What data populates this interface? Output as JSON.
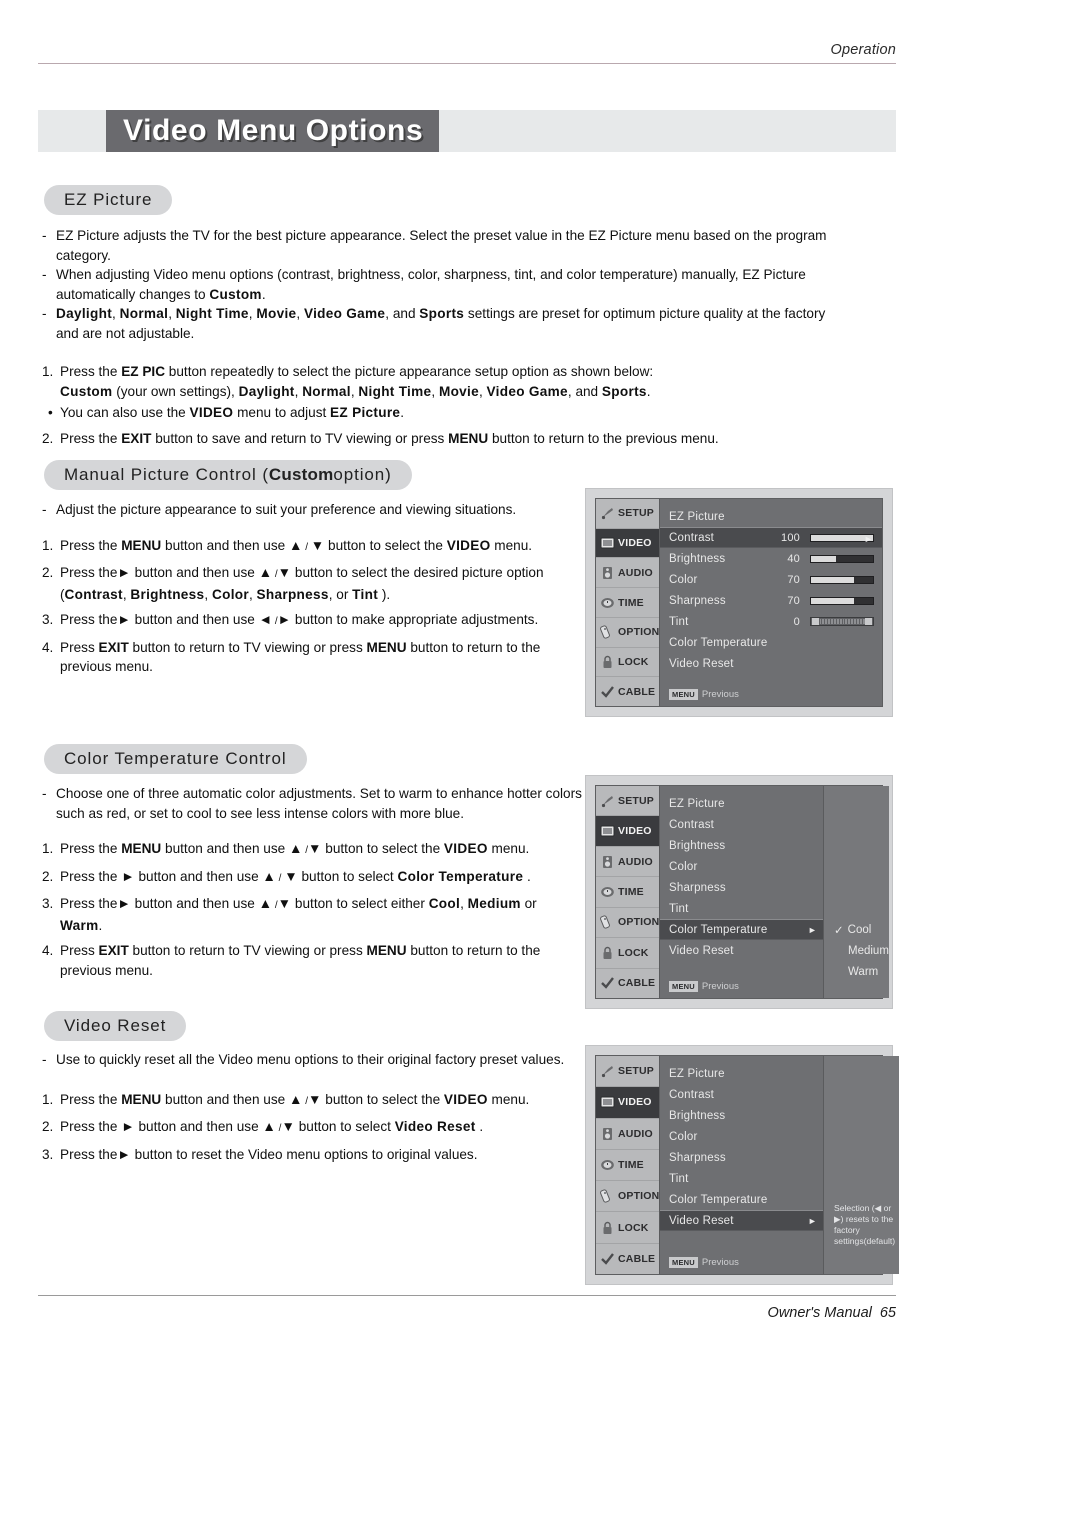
{
  "header": {
    "running_head": "Operation"
  },
  "banner": {
    "title": "Video Menu Options"
  },
  "sections": {
    "ez_picture": {
      "pill": "EZ Picture",
      "bullets": [
        "EZ Picture adjusts the TV for the best picture appearance. Select the preset value in the EZ Picture menu based on the program category.",
        "When adjusting Video menu options (contrast, brightness, color, sharpness, tint, and color temperature) manually, EZ Picture automatically changes to Custom.",
        "Daylight, Normal, Night Time, Movie, Video Game, and Sports settings are preset for optimum picture quality at the factory and are not adjustable."
      ],
      "step1_a": "Press the",
      "step1_b": "EZ PIC",
      "step1_c": "button repeatedly to select the picture appearance setup option as shown below:",
      "step1_list_a": "Custom",
      "step1_list_b": "(your own settings),",
      "step1_list_c": "Daylight",
      "step1_list_d": "Normal",
      "step1_list_e": "Night Time",
      "step1_list_f": "Movie",
      "step1_list_g": "Video Game",
      "step1_list_h": "and",
      "step1_list_i": "Sports",
      "subbullet_a": "You can also use the",
      "subbullet_b": "VIDEO",
      "subbullet_c": "menu to adjust",
      "subbullet_d": "EZ Picture",
      "step2_a": "Press the",
      "step2_b": "EXIT",
      "step2_c": "button to save and return to TV viewing or press",
      "step2_d": "MENU",
      "step2_e": "button to return to the previous menu."
    },
    "manual_picture": {
      "pill_a": "Manual Picture Control (",
      "pill_b": "Custom",
      "pill_c": " option)",
      "dash": "Adjust the picture appearance to suit your preference and viewing situations.",
      "step1_a": "Press the",
      "step1_b": "MENU",
      "step1_c": "button and then use",
      "step1_d": "button to select the",
      "step1_e": "VIDEO",
      "step1_f": "menu.",
      "step2_a": "Press the",
      "step2_b": "button and then use",
      "step2_c": "button to select the desired picture option",
      "step2_paren_open": "(",
      "step2_o1": "Contrast",
      "step2_o2": "Brightness",
      "step2_o3": "Color",
      "step2_o4": "Sharpness",
      "step2_or": ", or",
      "step2_o5": "Tint",
      "step2_paren_close": ").",
      "step3_a": "Press the",
      "step3_b": "button and then use",
      "step3_c": "button to make appropriate adjustments.",
      "step4_a": "Press",
      "step4_b": "EXIT",
      "step4_c": "button to return to TV viewing or press",
      "step4_d": "MENU",
      "step4_e": "button to return to the previous menu."
    },
    "color_temp": {
      "pill": "Color Temperature Control",
      "dash": "Choose one of three automatic color adjustments. Set to warm to enhance hotter colors such as red, or set to cool to see less intense colors with more blue.",
      "step1_a": "Press the",
      "step1_b": "MENU",
      "step1_c": "button and then use",
      "step1_d": "button to select the",
      "step1_e": "VIDEO",
      "step1_f": "menu.",
      "step2_a": "Press the",
      "step2_b": "button and then use",
      "step2_c": "button to select",
      "step2_d": "Color Temperature",
      "step2_e": ".",
      "step3_a": "Press the",
      "step3_b": "button and then use",
      "step3_c": "button to select either",
      "step3_d": "Cool",
      "step3_e": "Medium",
      "step3_f": "or",
      "step3_g": "Warm",
      "step3_h": ".",
      "step4_a": "Press",
      "step4_b": "EXIT",
      "step4_c": "button to return to TV viewing or press",
      "step4_d": "MENU",
      "step4_e": "button to return to the previous menu."
    },
    "video_reset": {
      "pill": "Video Reset",
      "dash": "Use to quickly reset all the Video menu options to their original factory preset values.",
      "step1_a": "Press the",
      "step1_b": "MENU",
      "step1_c": "button and then use",
      "step1_d": "button to select the",
      "step1_e": "VIDEO",
      "step1_f": "menu.",
      "step2_a": "Press the",
      "step2_b": "button and then use",
      "step2_c": "button to select",
      "step2_d": "Video Reset",
      "step2_e": ".",
      "step3_a": "Press the",
      "step3_b": "button to reset the Video menu options to original values."
    }
  },
  "osd": {
    "sidebar": [
      {
        "label": "SETUP",
        "icon": "satellite-dish-icon",
        "selected": false
      },
      {
        "label": "VIDEO",
        "icon": "tv-screen-icon",
        "selected": true
      },
      {
        "label": "AUDIO",
        "icon": "speaker-icon",
        "selected": false
      },
      {
        "label": "TIME",
        "icon": "clock-icon",
        "selected": false
      },
      {
        "label": "OPTION",
        "icon": "remote-control-icon",
        "selected": false
      },
      {
        "label": "LOCK",
        "icon": "padlock-icon",
        "selected": false
      },
      {
        "label": "CABLE",
        "icon": "checkmark-icon",
        "selected": false
      }
    ],
    "footer_key": "MENU",
    "footer_text": "Previous",
    "menu1": {
      "rows": [
        {
          "label": "EZ Picture",
          "value": "",
          "bar": null,
          "highlight": false
        },
        {
          "label": "Contrast",
          "value": "100",
          "bar": 100,
          "highlight": true
        },
        {
          "label": "Brightness",
          "value": "40",
          "bar": 40,
          "highlight": false
        },
        {
          "label": "Color",
          "value": "70",
          "bar": 70,
          "highlight": false
        },
        {
          "label": "Sharpness",
          "value": "70",
          "bar": 70,
          "highlight": false
        },
        {
          "label": "Tint",
          "value": "0",
          "bar": "tint",
          "highlight": false
        },
        {
          "label": "Color Temperature",
          "value": "",
          "bar": null,
          "highlight": false
        },
        {
          "label": "Video Reset",
          "value": "",
          "bar": null,
          "highlight": false
        }
      ],
      "tint_left_cap": "R",
      "tint_right_cap": "G"
    },
    "menu2": {
      "rows": [
        {
          "label": "EZ Picture",
          "highlight": false
        },
        {
          "label": "Contrast",
          "highlight": false
        },
        {
          "label": "Brightness",
          "highlight": false
        },
        {
          "label": "Color",
          "highlight": false
        },
        {
          "label": "Sharpness",
          "highlight": false
        },
        {
          "label": "Tint",
          "highlight": false
        },
        {
          "label": "Color Temperature",
          "highlight": true
        },
        {
          "label": "Video Reset",
          "highlight": false
        }
      ],
      "options": [
        {
          "label": "Cool",
          "checked": true
        },
        {
          "label": "Medium",
          "checked": false
        },
        {
          "label": "Warm",
          "checked": false
        }
      ]
    },
    "menu3": {
      "rows": [
        {
          "label": "EZ Picture",
          "highlight": false
        },
        {
          "label": "Contrast",
          "highlight": false
        },
        {
          "label": "Brightness",
          "highlight": false
        },
        {
          "label": "Color",
          "highlight": false
        },
        {
          "label": "Sharpness",
          "highlight": false
        },
        {
          "label": "Tint",
          "highlight": false
        },
        {
          "label": "Color Temperature",
          "highlight": false
        },
        {
          "label": "Video Reset",
          "highlight": true
        }
      ],
      "note": "Selection (◀ or ▶) resets to the factory settings(default)"
    }
  },
  "footer": {
    "manual_label": "Owner's Manual",
    "page_number": "65"
  },
  "colors": {
    "banner_band": "#e7e9ea",
    "banner_box": "#6a6a6e",
    "pill": "#d5d6d8",
    "header_rule": "#b9a8ae",
    "osd_frame": "#d4d5d7",
    "osd_body": "#6e6f72",
    "osd_sidebar": "#b8b9bb",
    "osd_selected": "#3a3b3e"
  }
}
